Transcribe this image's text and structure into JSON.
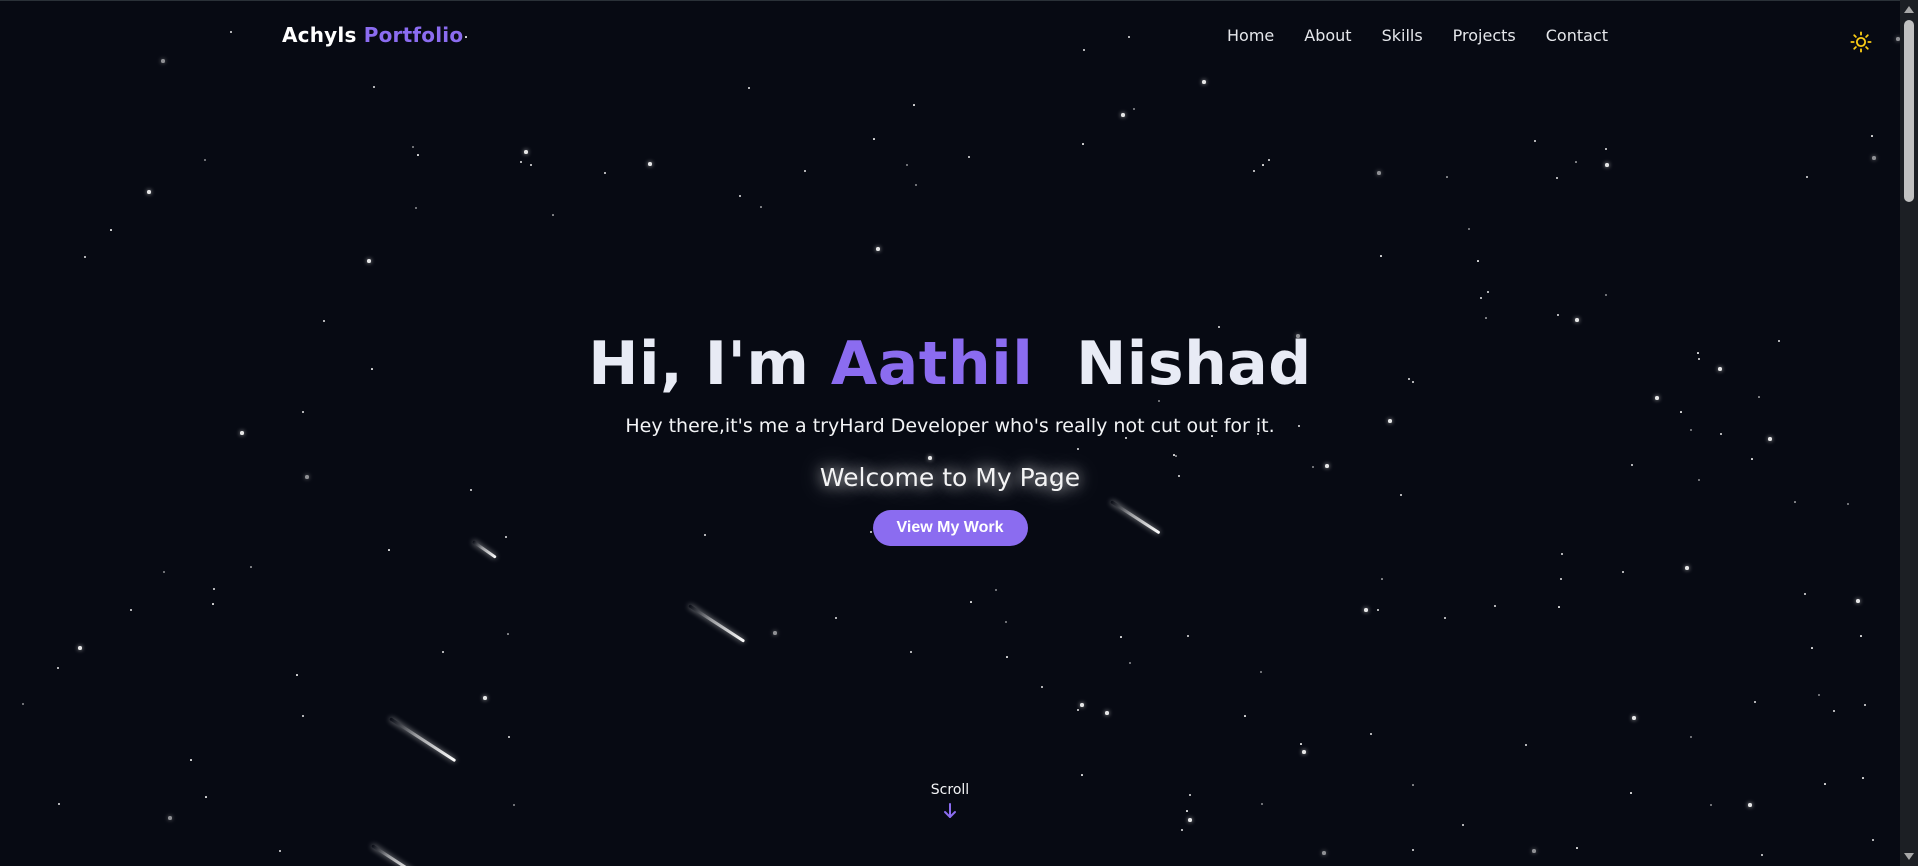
{
  "nav": {
    "brand_main": "Achyls",
    "brand_accent": "Portfolio",
    "links": [
      "Home",
      "About",
      "Skills",
      "Projects",
      "Contact"
    ],
    "theme_icon": "sun-icon"
  },
  "hero": {
    "greeting": "Hi, I'm",
    "first_name": "Aathil",
    "last_name": "Nishad",
    "subtitle": "Hey there,it's me a tryHard Developer who's really not cut out for it.",
    "welcome": "Welcome to My Page",
    "cta_label": "View My Work"
  },
  "scroll": {
    "label": "Scroll",
    "icon": "arrow-down-icon"
  },
  "colors": {
    "background": "#070a13",
    "accent": "#8b6cf0",
    "sun": "#facc15"
  }
}
